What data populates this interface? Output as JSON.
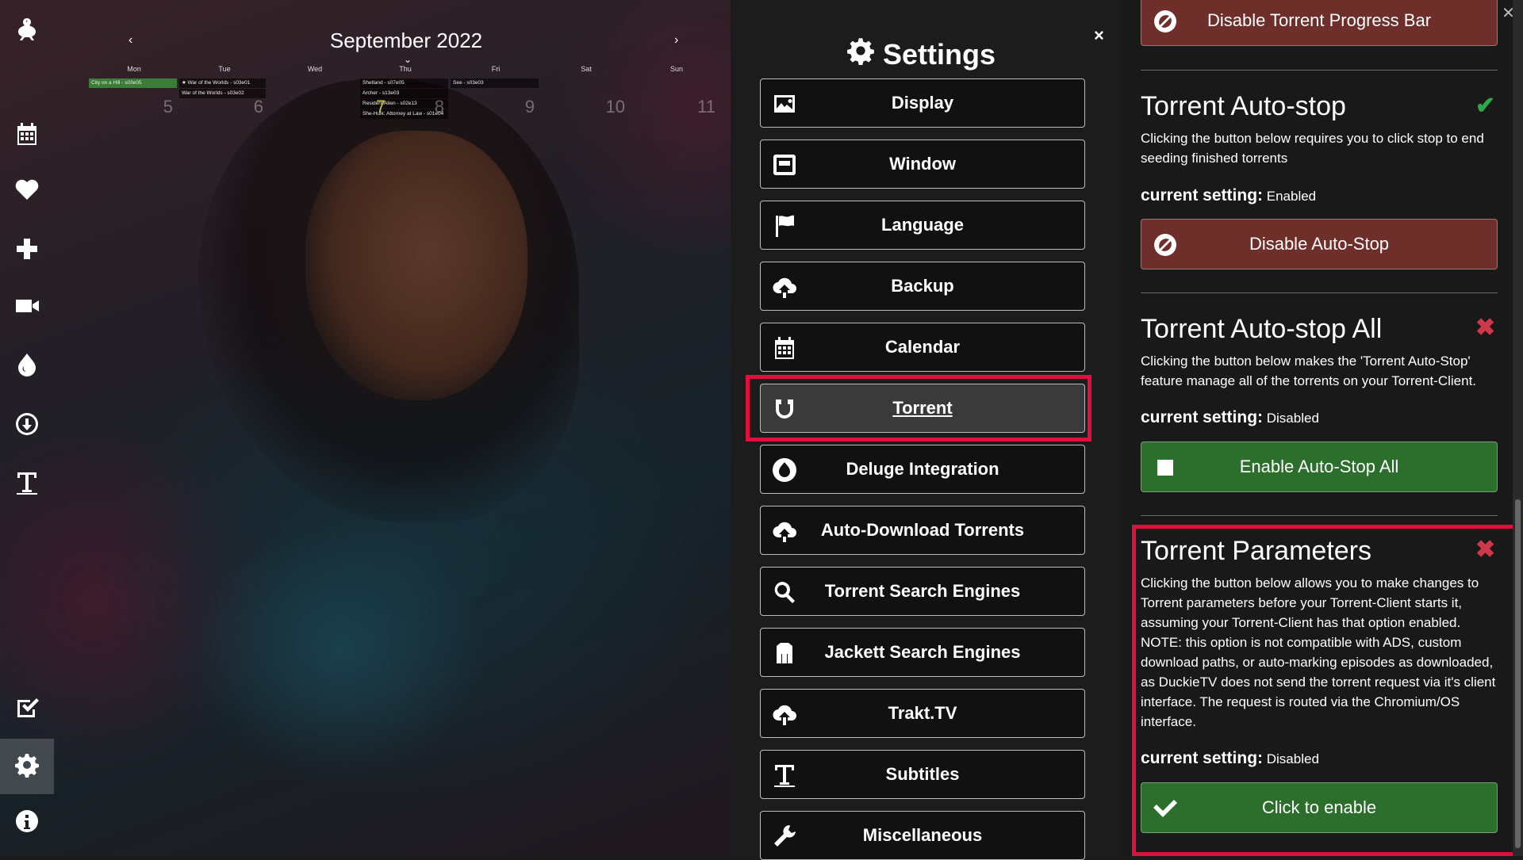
{
  "calendar": {
    "title": "September 2022",
    "prev": "‹",
    "next": "›",
    "caret": "⌄",
    "days_of_week": [
      "Mon",
      "Tue",
      "Wed",
      "Thu",
      "Fri",
      "Sat",
      "Sun"
    ],
    "dates": [
      "5",
      "6",
      "7",
      "8",
      "9",
      "10",
      "11"
    ],
    "today_index": 2,
    "events": {
      "mon_1": "City on a Hill - s03e05",
      "tue_1": "★ War of the Worlds - s03e01",
      "tue_2": "War of the Worlds - s03e02",
      "thu_1": "Shetland - s07e05",
      "thu_2": "Archer - s13e03",
      "thu_3": "Resident Alien - s02e13",
      "thu_4": "She-Hulk: Attorney at Law - s01e04",
      "fri_1": "See - s03e03"
    }
  },
  "sidebar": {
    "items": [
      {
        "icon": "logo-duck-icon"
      },
      {
        "icon": "calendar-icon"
      },
      {
        "icon": "heart-icon"
      },
      {
        "icon": "plus-icon"
      },
      {
        "icon": "video-camera-icon"
      },
      {
        "icon": "deluge-drop-icon"
      },
      {
        "icon": "download-icon"
      },
      {
        "icon": "subtitles-icon"
      },
      {
        "icon": "check-square-icon"
      },
      {
        "icon": "gear-icon",
        "active": true
      },
      {
        "icon": "info-icon"
      }
    ]
  },
  "settings": {
    "title": "Settings",
    "close": "×",
    "menu": [
      {
        "label": "Display",
        "icon": "image-icon"
      },
      {
        "label": "Window",
        "icon": "window-icon"
      },
      {
        "label": "Language",
        "icon": "flag-icon"
      },
      {
        "label": "Backup",
        "icon": "cloud-download-icon"
      },
      {
        "label": "Calendar",
        "icon": "calendar-icon"
      },
      {
        "label": "Torrent",
        "icon": "magnet-icon",
        "active": true
      },
      {
        "label": "Deluge Integration",
        "icon": "deluge-drop-icon"
      },
      {
        "label": "Auto-Download Torrents",
        "icon": "cloud-download-icon"
      },
      {
        "label": "Torrent Search Engines",
        "icon": "search-icon"
      },
      {
        "label": "Jackett Search Engines",
        "icon": "jacket-icon"
      },
      {
        "label": "Trakt.TV",
        "icon": "cloud-upload-icon"
      },
      {
        "label": "Subtitles",
        "icon": "subtitles-icon"
      },
      {
        "label": "Miscellaneous",
        "icon": "wrench-icon"
      }
    ]
  },
  "detail": {
    "progress_bar_button": "Disable Torrent Progress Bar",
    "sections": [
      {
        "title": "Torrent Auto-stop",
        "status": "✔",
        "description": "Clicking the button below requires you to click stop to end seeding finished torrents",
        "setting_label": "current setting:",
        "setting_value": "Enabled",
        "button": "Disable Auto-Stop"
      },
      {
        "title": "Torrent Auto-stop All",
        "status": "✖",
        "description": "Clicking the button below makes the 'Torrent Auto-Stop' feature manage all of the torrents on your Torrent-Client.",
        "setting_label": "current setting:",
        "setting_value": "Disabled",
        "button": "Enable Auto-Stop All"
      },
      {
        "title": "Torrent Parameters",
        "status": "✖",
        "description": "Clicking the button below allows you to make changes to Torrent parameters before your Torrent-Client starts it, assuming your Torrent-Client has that option enabled. NOTE: this option is not compatible with ADS, custom download paths, or auto-marking episodes as downloaded, as DuckieTV does not send the torrent request via it's client interface. The request is routed via the Chromium/OS interface.",
        "setting_label": "current setting:",
        "setting_value": "Disabled",
        "button": "Click to enable"
      }
    ]
  },
  "colors": {
    "highlight": "#e0103c",
    "ok": "#2fa84a",
    "no": "#d0384a",
    "red_button": "#6e2e2a",
    "green_button": "#2c6e2c"
  }
}
